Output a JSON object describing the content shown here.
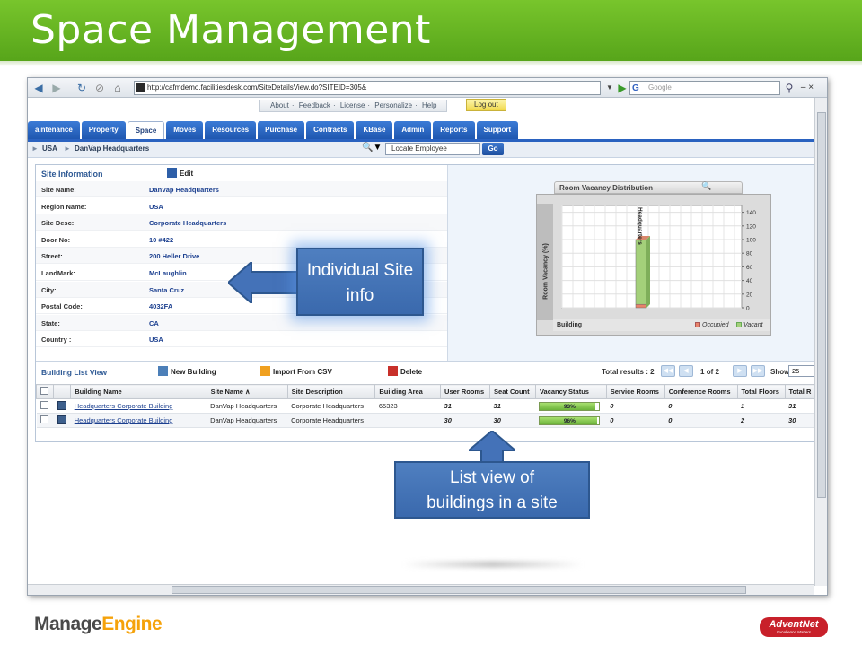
{
  "slide": {
    "title": "Space Management",
    "callout_site": "Individual Site info",
    "callout_list_line1": "List view of",
    "callout_list_line2": "buildings in a site",
    "footer_left_a": "Manage",
    "footer_left_b": "Engine",
    "footer_right": "AdventNet",
    "footer_right_sub": "Excellence Matters"
  },
  "browser": {
    "url": "http://cafmdemo.facilitiesdesk.com/SiteDetailsView.do?SITEID=305&",
    "search_placeholder": "Google"
  },
  "app": {
    "top_links": [
      "About",
      "Feedback",
      "License",
      "Personalize",
      "Help"
    ],
    "logout": "Log out",
    "tabs": [
      "aintenance",
      "Property",
      "Space",
      "Moves",
      "Resources",
      "Purchase",
      "Contracts",
      "KBase",
      "Admin",
      "Reports",
      "Support"
    ],
    "active_tab": "Space",
    "breadcrumb": [
      "USA",
      "DanVap Headquarters"
    ],
    "locate_placeholder": "Locate Employee",
    "go": "Go"
  },
  "site_info": {
    "header": "Site Information",
    "edit": "Edit",
    "rows": [
      {
        "label": "Site Name:",
        "value": "DanVap Headquarters"
      },
      {
        "label": "Region Name:",
        "value": "USA"
      },
      {
        "label": "Site Desc:",
        "value": "Corporate Headquarters"
      },
      {
        "label": "Door No:",
        "value": "10 #422"
      },
      {
        "label": "Street:",
        "value": "200 Heller Drive"
      },
      {
        "label": "LandMark:",
        "value": "McLaughlin"
      },
      {
        "label": "City:",
        "value": "Santa Cruz"
      },
      {
        "label": "Postal Code:",
        "value": "4032FA"
      },
      {
        "label": "State:",
        "value": "CA"
      },
      {
        "label": "Country :",
        "value": "USA"
      }
    ]
  },
  "chart_data": {
    "type": "bar",
    "title": "Room Vacancy Distribution",
    "ylabel": "Room Vacancy (%)",
    "xlabel": "Building",
    "categories": [
      "Headquarters"
    ],
    "series": [
      {
        "name": "Occupied",
        "values": [
          5
        ],
        "color": "#e8836a"
      },
      {
        "name": "Vacant",
        "values": [
          95
        ],
        "color": "#a4d07a"
      }
    ],
    "stacked": true,
    "ylim": [
      0,
      150
    ],
    "yticks": [
      "0",
      "20",
      "40",
      "60",
      "80",
      "100",
      "120",
      "140"
    ],
    "grid": true,
    "legend": "bottom-right"
  },
  "building_list": {
    "title": "Building List View",
    "new_building": "New Building",
    "import_csv": "Import From CSV",
    "delete": "Delete",
    "results": "Total results : 2",
    "page_num": "1",
    "page_of": "of",
    "page_total": "2",
    "show_label": "Show",
    "show_value": "25",
    "columns": [
      "Building Name",
      "Site Name ∧",
      "Site Description",
      "Building Area",
      "User Rooms",
      "Seat Count",
      "Vacancy Status",
      "Service Rooms",
      "Conference Rooms",
      "Total Floors",
      "Total R"
    ],
    "rows": [
      {
        "building_name": "Headquarters Corporate Building",
        "site_name": "DanVap Headquarters",
        "site_description": "Corporate Headquarters",
        "building_area": "65323",
        "user_rooms": "31",
        "seat_count": "31",
        "vacancy": 0.93,
        "vacancy_text": "93%",
        "service_rooms": "0",
        "conference_rooms": "0",
        "total_floors": "1",
        "total_r": "31"
      },
      {
        "building_name": "Headquarters Corporate Building",
        "site_name": "DanVap Headquarters",
        "site_description": "Corporate Headquarters",
        "building_area": "",
        "user_rooms": "30",
        "seat_count": "30",
        "vacancy": 0.96,
        "vacancy_text": "96%",
        "service_rooms": "0",
        "conference_rooms": "0",
        "total_floors": "2",
        "total_r": "30"
      }
    ]
  },
  "colors": {
    "header_green": "#66b523",
    "tab_blue": "#2a62c0",
    "callout_blue": "#4472b8",
    "link_blue": "#1b3f8f"
  }
}
